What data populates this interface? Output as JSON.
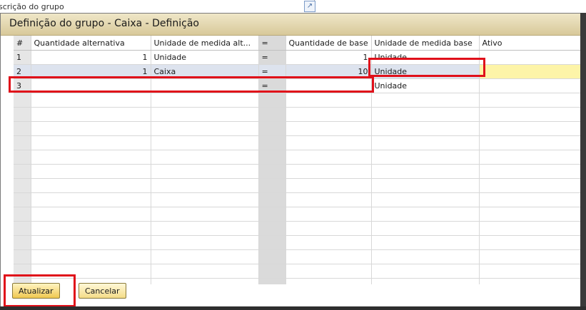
{
  "background": {
    "label": "scrição do grupo"
  },
  "dialog": {
    "title": "Definição do grupo - Caixa - Definição"
  },
  "columns": [
    "#",
    "Quantidade alternativa",
    "Unidade de medida alt...",
    "=",
    "Quantidade de base",
    "Unidade de medida base",
    "Ativo"
  ],
  "rows": [
    {
      "num": "1",
      "alt_qty": "1",
      "alt_uom": "Unidade",
      "eq": "=",
      "base_qty": "1",
      "base_uom": "Unidade",
      "active": ""
    },
    {
      "num": "2",
      "alt_qty": "1",
      "alt_uom": "Caixa",
      "eq": "=",
      "base_qty": "10",
      "base_uom": "Unidade",
      "active": ""
    },
    {
      "num": "3",
      "alt_qty": "",
      "alt_uom": "",
      "eq": "=",
      "base_qty": "",
      "base_uom": "Unidade",
      "active": ""
    }
  ],
  "buttons": {
    "update": "Atualizar",
    "cancel": "Cancelar"
  },
  "colors": {
    "highlight": "#e0101a",
    "button": "#f0c850",
    "title_bar": "#d8c99a",
    "active_cell": "#fdf4a8"
  }
}
